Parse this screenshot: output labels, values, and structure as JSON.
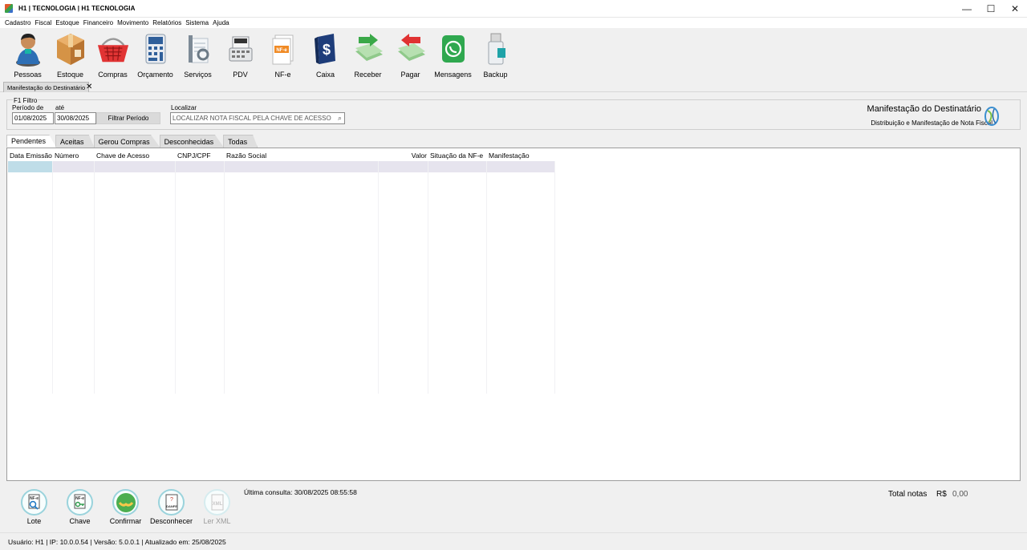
{
  "window": {
    "title": "H1  | TECNOLOGIA | H1 TECNOLOGIA",
    "minimize": "—",
    "maximize": "☐",
    "close": "✕"
  },
  "menu": [
    "Cadastro",
    "Fiscal",
    "Estoque",
    "Financeiro",
    "Movimento",
    "Relatórios",
    "Sistema",
    "Ajuda"
  ],
  "toolbar": [
    {
      "label": "Pessoas",
      "icon": "person-icon"
    },
    {
      "label": "Estoque",
      "icon": "box-icon"
    },
    {
      "label": "Compras",
      "icon": "basket-icon"
    },
    {
      "label": "Orçamento",
      "icon": "calculator-icon"
    },
    {
      "label": "Serviços",
      "icon": "tools-icon"
    },
    {
      "label": "PDV",
      "icon": "cash-register-icon"
    },
    {
      "label": "NF-e",
      "icon": "nfe-document-icon"
    },
    {
      "label": "Caixa",
      "icon": "money-book-icon"
    },
    {
      "label": "Receber",
      "icon": "receive-money-icon"
    },
    {
      "label": "Pagar",
      "icon": "pay-money-icon"
    },
    {
      "label": "Mensagens",
      "icon": "whatsapp-icon"
    },
    {
      "label": "Backup",
      "icon": "usb-drive-icon"
    }
  ],
  "doc_tab": {
    "label": "Manifestação do Destinatário",
    "close": "✕"
  },
  "filter": {
    "section_label": "F1 Filtro",
    "period_from_label": "Período de",
    "period_to_label": "até",
    "date_from": "01/08/2025",
    "date_to": "30/08/2025",
    "filter_button": "Filtrar Período",
    "search_label": "Localizar",
    "search_placeholder": "LOCALIZAR NOTA FISCAL PELA CHAVE DE ACESSO",
    "search_icon": "⌕"
  },
  "header_right": {
    "title": "Manifestação do Destinatário",
    "subtitle": "Distribuição e Manifestação de Nota Fiscal"
  },
  "tabs": [
    "Pendentes",
    "Aceitas",
    "Gerou Compras",
    "Desconhecidas",
    "Todas"
  ],
  "grid": {
    "columns": [
      "Data Emissão",
      "Número",
      "Chave de Acesso",
      "CNPJ/CPF",
      "Razão Social",
      "Valor",
      "Situação da NF-e",
      "Manifestação"
    ]
  },
  "actions": [
    {
      "label": "Lote",
      "icon": "nfe-search-icon",
      "enabled": true
    },
    {
      "label": "Chave",
      "icon": "nfe-key-icon",
      "enabled": true
    },
    {
      "label": "Confirmar",
      "icon": "confirm-handshake-icon",
      "enabled": true
    },
    {
      "label": "Desconhecer",
      "icon": "danfe-unknown-icon",
      "enabled": true
    },
    {
      "label": "Ler XML",
      "icon": "xml-icon",
      "enabled": false
    }
  ],
  "last_query": "Última consulta: 30/08/2025 08:55:58",
  "totals": {
    "label": "Total notas",
    "currency": "R$",
    "value": "0,00"
  },
  "status": "Usuário: H1 | IP: 10.0.0.54 | Versão: 5.0.0.1 | Atualizado em: 25/08/2025"
}
